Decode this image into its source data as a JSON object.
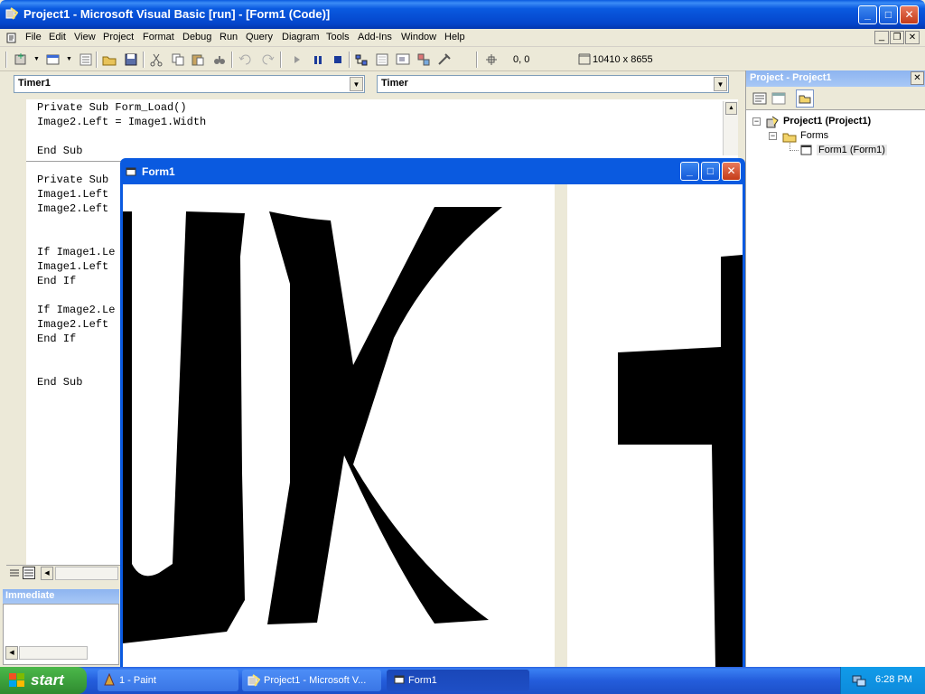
{
  "main_window": {
    "title": "Project1 - Microsoft Visual Basic [run] - [Form1 (Code)]",
    "controls": {
      "minimize": "_",
      "maximize": "□",
      "close": "✕"
    }
  },
  "menubar": {
    "items": [
      {
        "label": "File"
      },
      {
        "label": "Edit"
      },
      {
        "label": "View"
      },
      {
        "label": "Project"
      },
      {
        "label": "Format"
      },
      {
        "label": "Debug"
      },
      {
        "label": "Run"
      },
      {
        "label": "Query"
      },
      {
        "label": "Diagram"
      },
      {
        "label": "Tools"
      },
      {
        "label": "Add-Ins"
      },
      {
        "label": "Window"
      },
      {
        "label": "Help"
      }
    ],
    "mdi_controls": {
      "minimize": "_",
      "restore": "❐",
      "close": "✕"
    }
  },
  "toolbar": {
    "position_readout": "0, 0",
    "size_readout": "10410 x 8655"
  },
  "code_window": {
    "object_combo": "Timer1",
    "procedure_combo": "Timer",
    "lines": [
      "Private Sub Form_Load()",
      "Image2.Left = Image1.Width",
      "",
      "End Sub",
      "Private Sub",
      "Image1.Left",
      "Image2.Left",
      "",
      "",
      "If Image1.Le",
      "Image1.Left",
      "End If",
      "",
      "If Image2.Le",
      "Image2.Left",
      "End If",
      "",
      "",
      "End Sub"
    ]
  },
  "project_panel": {
    "title": "Project - Project1",
    "close": "✕",
    "tree": {
      "root": "Project1 (Project1)",
      "folder": "Forms",
      "item": "Form1 (Form1)"
    }
  },
  "immediate": {
    "title": "Immediate"
  },
  "form1": {
    "title": "Form1",
    "controls": {
      "minimize": "_",
      "maximize": "□",
      "close": "✕"
    }
  },
  "taskbar": {
    "start_label": "start",
    "tasks": [
      {
        "label": "1 - Paint",
        "active": false
      },
      {
        "label": "Project1 - Microsoft V...",
        "active": false
      },
      {
        "label": "Form1",
        "active": true
      }
    ],
    "clock": "6:28 PM"
  },
  "colors": {
    "xp_blue": "#0a5ae0",
    "face": "#ece9d8",
    "start_green": "#3a9d3a"
  }
}
